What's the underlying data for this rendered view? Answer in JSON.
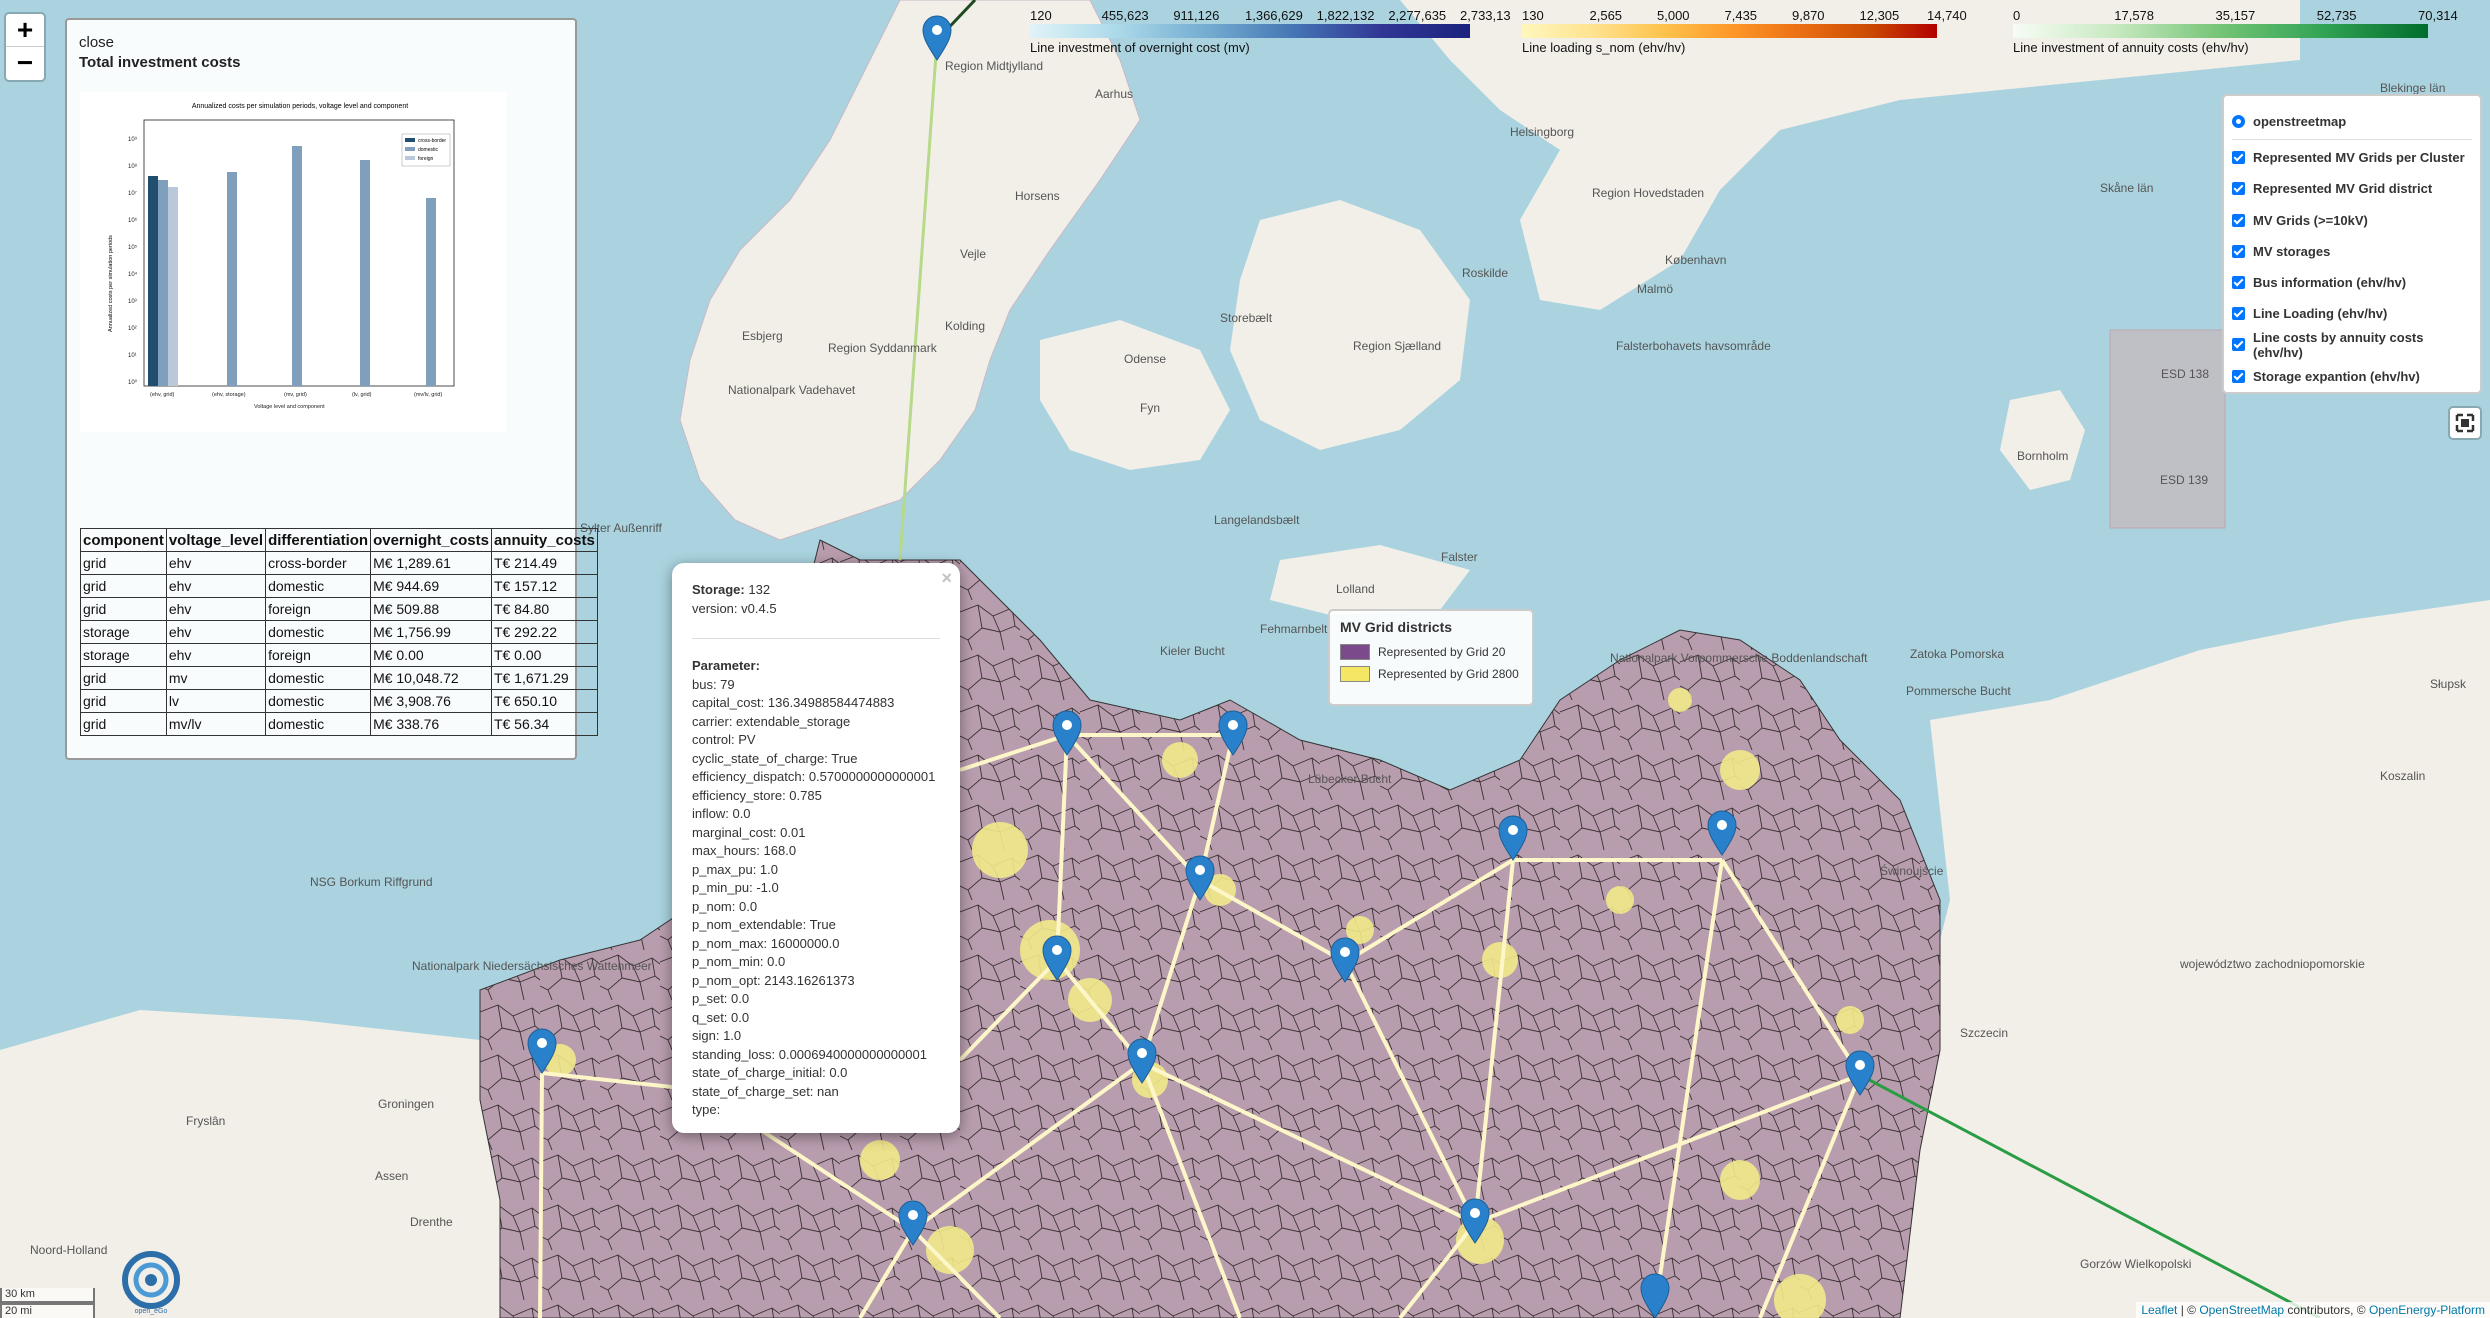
{
  "zoom": {
    "in": "+",
    "out": "−"
  },
  "panel": {
    "close": "close",
    "title": "Total investment costs",
    "chart_image": {
      "title": "Annualized costs per simulation periods, voltage level and component",
      "xlabel": "Voltage level and component",
      "ylabel": "Annualized costs per simulation periods",
      "categories": [
        "(ehv, grid)",
        "(ehv, storage)",
        "(mv, grid)",
        "(lv, grid)",
        "(mv/lv, grid)"
      ],
      "legend": [
        "cross-border",
        "domestic",
        "foreign"
      ]
    },
    "table": {
      "headers": [
        "component",
        "voltage_level",
        "differentiation",
        "overnight_costs",
        "annuity_costs"
      ],
      "rows": [
        [
          "grid",
          "ehv",
          "cross-border",
          "M€ 1,289.61",
          "T€ 214.49"
        ],
        [
          "grid",
          "ehv",
          "domestic",
          "M€ 944.69",
          "T€ 157.12"
        ],
        [
          "grid",
          "ehv",
          "foreign",
          "M€ 509.88",
          "T€ 84.80"
        ],
        [
          "storage",
          "ehv",
          "domestic",
          "M€ 1,756.99",
          "T€ 292.22"
        ],
        [
          "storage",
          "ehv",
          "foreign",
          "M€ 0.00",
          "T€ 0.00"
        ],
        [
          "grid",
          "mv",
          "domestic",
          "M€ 10,048.72",
          "T€ 1,671.29"
        ],
        [
          "grid",
          "lv",
          "domestic",
          "M€ 3,908.76",
          "T€ 650.10"
        ],
        [
          "grid",
          "mv/lv",
          "domestic",
          "M€ 338.76",
          "T€ 56.34"
        ]
      ]
    }
  },
  "popup": {
    "close": "×",
    "storage_label": "Storage:",
    "storage_value": "132",
    "version": "version: v0.4.5",
    "param_label": "Parameter:",
    "params": [
      "bus: 79",
      "capital_cost: 136.34988584474883",
      "carrier: extendable_storage",
      "control: PV",
      "cyclic_state_of_charge: True",
      "efficiency_dispatch: 0.5700000000000001",
      "efficiency_store: 0.785",
      "inflow: 0.0",
      "marginal_cost: 0.01",
      "max_hours: 168.0",
      "p_max_pu: 1.0",
      "p_min_pu: -1.0",
      "p_nom: 0.0",
      "p_nom_extendable: True",
      "p_nom_max: 16000000.0",
      "p_nom_min: 0.0",
      "p_nom_opt: 2143.16261373",
      "p_set: 0.0",
      "q_set: 0.0",
      "sign: 1.0",
      "standing_loss: 0.0006940000000000001",
      "state_of_charge_initial: 0.0",
      "state_of_charge_set: nan",
      "type:"
    ]
  },
  "layers": {
    "base": "openstreetmap",
    "overlays": [
      "Represented MV Grids per Cluster",
      "Represented MV Grid district",
      "MV Grids (>=10kV)",
      "MV storages",
      "Bus information (ehv/hv)",
      "Line Loading (ehv/hv)",
      "Line costs by annuity costs (ehv/hv)",
      "Storage expantion (ehv/hv)"
    ]
  },
  "grid_legend": {
    "title": "MV Grid districts",
    "items": [
      {
        "label": "Represented by Grid 20",
        "color": "#7b4a8b"
      },
      {
        "label": "Represented by Grid 2800",
        "color": "#f5e663"
      }
    ]
  },
  "colorbars": [
    {
      "ticks": [
        "120",
        "455,623",
        "911,126",
        "1,366,629",
        "1,822,132",
        "2,277,635",
        "2,733,13"
      ],
      "caption": "Line investment of overnight cost (mv)",
      "colors": [
        "#e0f3f8",
        "#abd9e9",
        "#74add1",
        "#4575b4",
        "#313695",
        "#1a237e"
      ]
    },
    {
      "ticks": [
        "130",
        "2,565",
        "5,000",
        "7,435",
        "9,870",
        "12,305",
        "14,740"
      ],
      "caption": "Line loading s_nom (ehv/hv)",
      "colors": [
        "#fff7bc",
        "#fee391",
        "#fec44f",
        "#fe9929",
        "#ec7014",
        "#cc4c02",
        "#b30000"
      ]
    },
    {
      "ticks": [
        "0",
        "17,578",
        "35,157",
        "52,735",
        "70,314"
      ],
      "caption": "Line investment of annuity costs (ehv/hv)",
      "colors": [
        "#f7fcf5",
        "#c7e9c0",
        "#74c476",
        "#31a354",
        "#006d2c"
      ]
    }
  ],
  "map_labels": [
    "Region Midtjylland",
    "Aarhus",
    "Horsens",
    "Vejle",
    "Kolding",
    "Esbjerg",
    "Region Syddanmark",
    "Nationalpark Vadehavet",
    "Odense",
    "Fyn",
    "Helsingborg",
    "Region Hovedstaden",
    "København",
    "Roskilde",
    "Malmö",
    "Skåne län",
    "Region Sjælland",
    "Falsterbohavets havsområde",
    "Langelandsbælt",
    "Lolland",
    "Falster",
    "Bornholm",
    "ESD 138",
    "ESD 139",
    "Blekinge län",
    "Kieler Bucht",
    "Fehmarnbelt",
    "Lübecker Bucht",
    "Nationalpark Vorpommersche Boddenlandschaft",
    "Zatoka Pomorska",
    "Pommersche Bucht",
    "Słupsk",
    "Koszalin",
    "Szczecin",
    "województwo zachodniopomorskie",
    "Świnoujście",
    "Groningen",
    "Fryslân",
    "Assen",
    "Drenthe",
    "Noord-Holland",
    "Nationalpark Niedersächsisches Wattenmeer",
    "NSG Borkum Riffgrund",
    "Gorzów Wielkopolski",
    "Sylter Außenriff",
    "Storebælt"
  ],
  "scale": {
    "km": "30 km",
    "mi": "20 mi"
  },
  "attribution": {
    "leaflet": "Leaflet",
    "sep": " | © ",
    "osm": "OpenStreetMap",
    "contrib": " contributors, © ",
    "oep": "OpenEnergy-Platform"
  },
  "logo_text": "open_eGo"
}
